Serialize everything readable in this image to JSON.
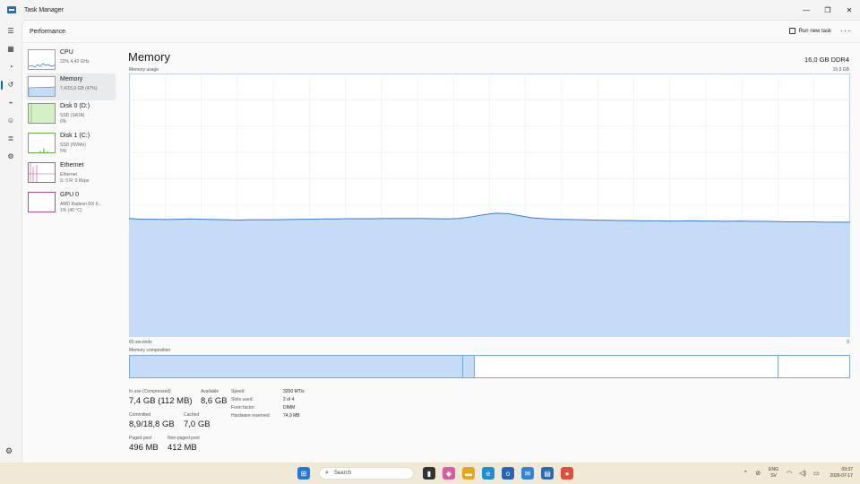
{
  "window": {
    "title": "Task Manager",
    "minimize": "—",
    "restore": "❐",
    "close": "✕"
  },
  "header": {
    "page_title": "Performance",
    "run_new_task": "Run new task",
    "more": "···"
  },
  "perf_items": [
    {
      "name": "CPU",
      "sub1": "22% 4,42 GHz",
      "sub2": "",
      "sub3": ""
    },
    {
      "name": "Memory",
      "sub1": "7,4/15,9 GB (47%)",
      "sub2": "",
      "sub3": ""
    },
    {
      "name": "Disk 0 (D:)",
      "sub1": "SSD (SATA)",
      "sub2": "0%",
      "sub3": ""
    },
    {
      "name": "Disk 1 (C:)",
      "sub1": "SSD (NVMe)",
      "sub2": "5%",
      "sub3": ""
    },
    {
      "name": "Ethernet",
      "sub1": "Ethernet",
      "sub2": "S: 0 R: 0 Kbps",
      "sub3": ""
    },
    {
      "name": "GPU 0",
      "sub1": "AMD Radeon RX 6...",
      "sub2": "1% (40 °C)",
      "sub3": ""
    }
  ],
  "main": {
    "title": "Memory",
    "spec": "16,0 GB DDR4",
    "usage_label": "Memory usage",
    "usage_max": "15,9 GB",
    "axis_left": "60 seconds",
    "axis_right": "0",
    "composition_label": "Memory composition"
  },
  "memory_usage_history": [
    0.45,
    0.447,
    0.447,
    0.446,
    0.447,
    0.448,
    0.447,
    0.446,
    0.445,
    0.444,
    0.445,
    0.445,
    0.445,
    0.446,
    0.447,
    0.447,
    0.448,
    0.448,
    0.449,
    0.449,
    0.449,
    0.45,
    0.45,
    0.45,
    0.45,
    0.449,
    0.448,
    0.45,
    0.456,
    0.464,
    0.47,
    0.468,
    0.46,
    0.452,
    0.449,
    0.447,
    0.446,
    0.445,
    0.444,
    0.443,
    0.442,
    0.442,
    0.441,
    0.441,
    0.44,
    0.44,
    0.441,
    0.44,
    0.44,
    0.439,
    0.44,
    0.439,
    0.439,
    0.438,
    0.437,
    0.437,
    0.437,
    0.436,
    0.436,
    0.436
  ],
  "composition": {
    "in_use_fraction": 0.463,
    "modified_fraction": 0.017,
    "standby_fraction": 0.422,
    "free_fraction": 0.098
  },
  "stats": {
    "in_use_label": "In use (Compressed)",
    "in_use_value": "7,4 GB (112 MB)",
    "available_label": "Available",
    "available_value": "8,6 GB",
    "committed_label": "Committed",
    "committed_value": "8,9/18,8 GB",
    "cached_label": "Cached",
    "cached_value": "7,0 GB",
    "paged_label": "Paged pool",
    "paged_value": "496 MB",
    "nonpaged_label": "Non-paged pool",
    "nonpaged_value": "412 MB"
  },
  "specs": [
    {
      "k": "Speed:",
      "v": "3200 MT/s"
    },
    {
      "k": "Slots used:",
      "v": "2 of 4"
    },
    {
      "k": "Form factor:",
      "v": "DIMM"
    },
    {
      "k": "Hardware reserved:",
      "v": "74,9 MB"
    }
  ],
  "taskbar": {
    "search_placeholder": "Search",
    "lang_line1": "ENG",
    "lang_line2": "SV",
    "time": "03:37",
    "date": "2026-07-17"
  },
  "colors": {
    "accent": "#0067c0",
    "graph_fill": "#c6dbf7",
    "graph_line": "#3d7cc9",
    "taskbar": "#efe9d6"
  }
}
